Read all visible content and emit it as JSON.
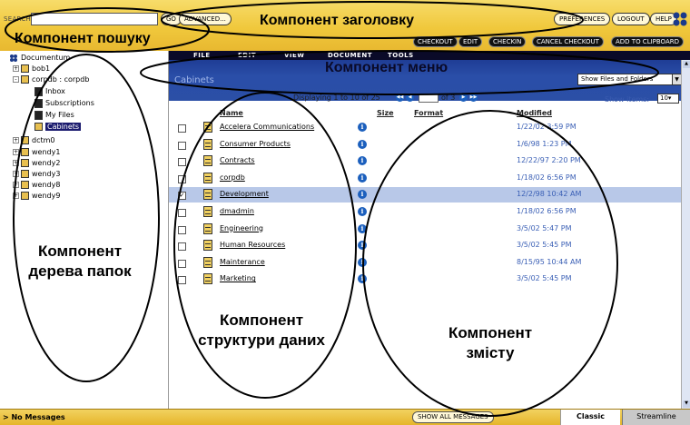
{
  "search": {
    "label": "SEARCH",
    "go_label": "GO",
    "advanced_label": "ADVANCED..."
  },
  "header_buttons": {
    "preferences": "PREFERENCES",
    "logout": "LOGOUT",
    "help": "HELP"
  },
  "actions": {
    "checkout": "CHECKOUT",
    "edit": "EDIT",
    "checkin": "CHECKIN",
    "cancel_checkout": "CANCEL CHECKOUT",
    "add_to_clipboard": "ADD TO CLIPBOARD"
  },
  "menu": {
    "file": "FILE",
    "edit": "EDIT",
    "view": "VIEW",
    "document": "DOCUMENT",
    "tools": "TOOLS"
  },
  "tree": {
    "root": "Documentum",
    "items": [
      {
        "label": "bob1",
        "expander": "+"
      },
      {
        "label": "corpdb : corpdb",
        "expander": "-"
      },
      {
        "label": "Inbox"
      },
      {
        "label": "Subscriptions"
      },
      {
        "label": "My Files"
      },
      {
        "label": "Cabinets"
      },
      {
        "label": "dctm0",
        "expander": "+"
      },
      {
        "label": "wendy1",
        "expander": "+"
      },
      {
        "label": "wendy2",
        "expander": "+"
      },
      {
        "label": "wendy3",
        "expander": "+"
      },
      {
        "label": "wendy8",
        "expander": "+"
      },
      {
        "label": "wendy9",
        "expander": "+"
      }
    ]
  },
  "main": {
    "title": "Cabinets",
    "show_select": "Show Files and Folders",
    "displaying": "Displaying 1 to 10 of 25",
    "page_value": "1",
    "page_of": "of 3",
    "show_items_label": "Show items:",
    "show_items_value": "10"
  },
  "columns": {
    "name": "Name",
    "size": "Size",
    "format": "Format",
    "modified": "Modified"
  },
  "rows": [
    {
      "name": "Accelera Communications",
      "modified": "1/22/02 3:59 PM"
    },
    {
      "name": "Consumer Products",
      "modified": "1/6/98 1:23 PM"
    },
    {
      "name": "Contracts",
      "modified": "12/22/97 2:20 PM"
    },
    {
      "name": "corpdb",
      "modified": "1/18/02 6:56 PM"
    },
    {
      "name": "Development",
      "modified": "12/2/98 10:42 AM"
    },
    {
      "name": "dmadmin",
      "modified": "1/18/02 6:56 PM"
    },
    {
      "name": "Engineering",
      "modified": "3/5/02 5:47 PM"
    },
    {
      "name": "Human Resources",
      "modified": "3/5/02 5:45 PM"
    },
    {
      "name": "Mainterance",
      "modified": "8/15/95 10:44 AM"
    },
    {
      "name": "Marketing",
      "modified": "3/5/02 5:45 PM"
    }
  ],
  "status": {
    "messages": "> No Messages",
    "show_all": "SHOW ALL MESSAGES",
    "tab_classic": "Classic",
    "tab_streamline": "Streamline"
  },
  "annotations": {
    "search": "Компонент пошуку",
    "header": "Компонент заголовку",
    "menu": "Компонент меню",
    "tree": "Компонент дерева папок",
    "data": "Компонент структури даних",
    "content": "Компонент змісту"
  },
  "colors": {
    "topbar": "#f0c83c",
    "menubar": "#0a0a28",
    "titlebar": "#2b4fa6",
    "selected_row": "#b8c8e8",
    "link_blue": "#3a5fb5"
  }
}
